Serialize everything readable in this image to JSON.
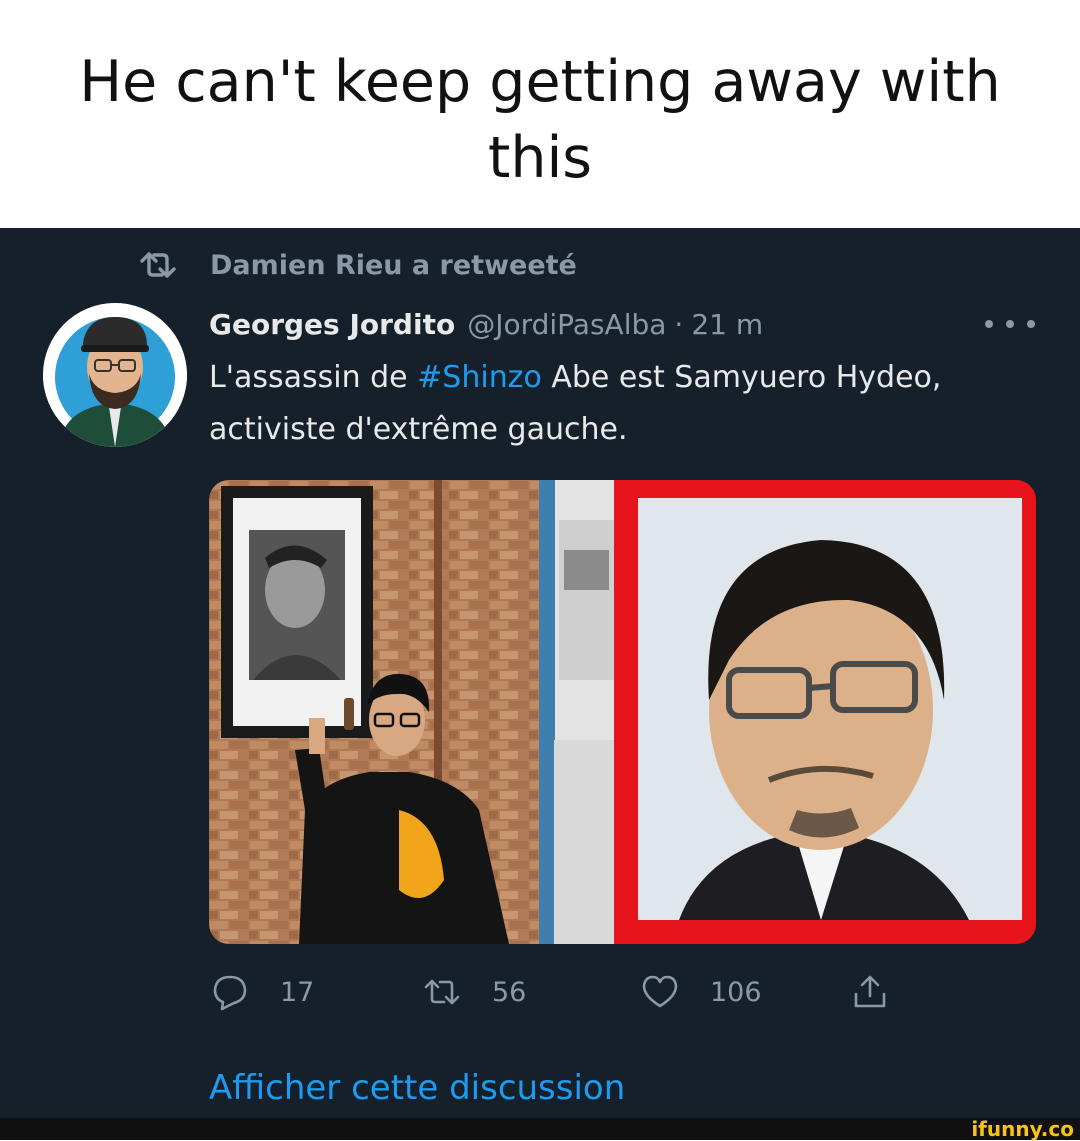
{
  "caption": {
    "line1": "He can't keep getting away with",
    "line2": "this"
  },
  "retweet": {
    "icon": "retweet-icon",
    "label": "Damien Rieu a retweeté"
  },
  "tweet": {
    "author_name": "Georges Jordito",
    "author_handle": "@JordiPasAlba",
    "separator": "·",
    "time": "21 m",
    "more_icon": "more-options-icon",
    "text_before": "L'assassin de ",
    "hashtag": "#Shinzo",
    "text_after": " Abe est Samyuero Hydeo, activiste d'extrême gauche.",
    "media": {
      "left_icon": "photo-man-pointing-at-portrait",
      "right_icon": "photo-portrait-with-red-border",
      "border_color": "#e8141c"
    }
  },
  "actions": {
    "reply": {
      "icon": "reply-icon",
      "count": "17"
    },
    "retweet": {
      "icon": "retweet-icon",
      "count": "56"
    },
    "like": {
      "icon": "heart-icon",
      "count": "106"
    },
    "share": {
      "icon": "share-icon"
    }
  },
  "show_thread": "Afficher cette discussion",
  "watermark": "ifunny.co",
  "colors": {
    "background": "#15202b",
    "primary_text": "#e7e9ea",
    "secondary_text": "#8b98a5",
    "accent": "#1d9bf0"
  }
}
